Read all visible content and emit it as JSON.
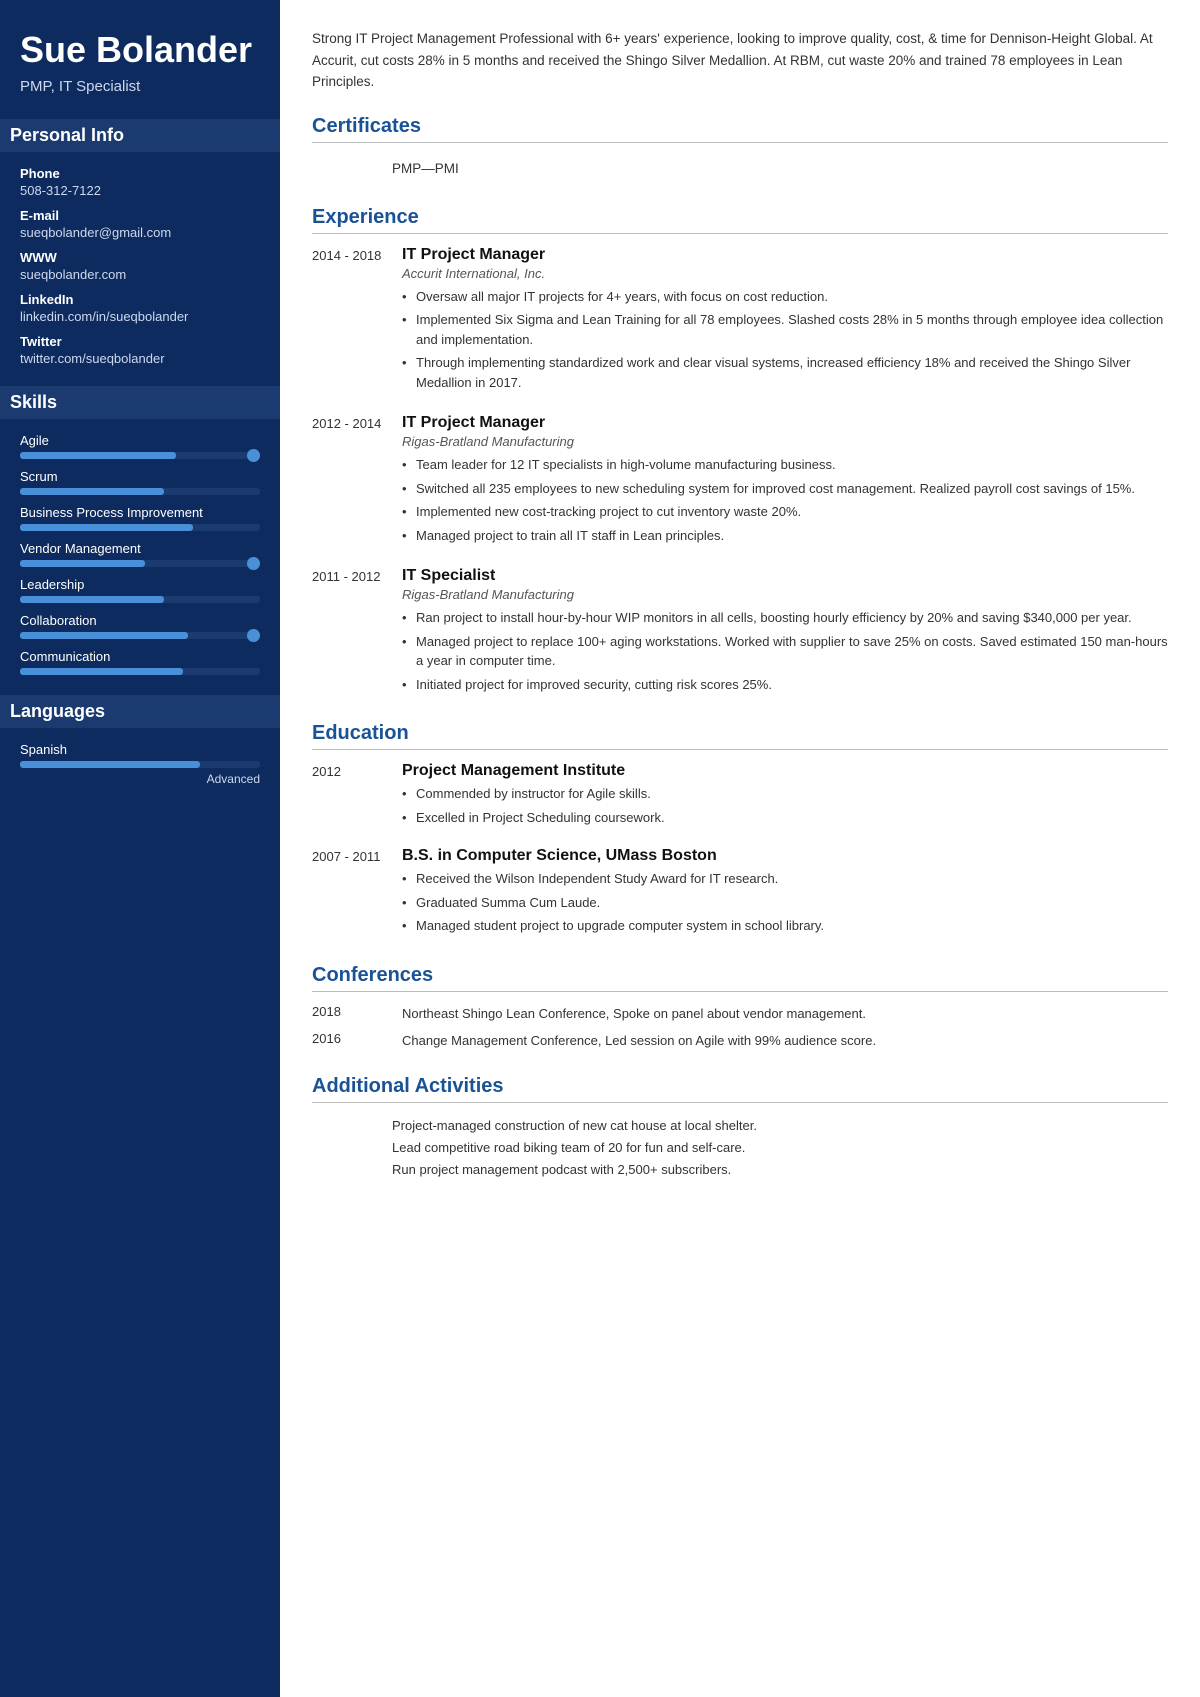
{
  "sidebar": {
    "name": "Sue Bolander",
    "title": "PMP, IT Specialist",
    "personal_info_header": "Personal Info",
    "phone_label": "Phone",
    "phone": "508-312-7122",
    "email_label": "E-mail",
    "email": "sueqbolander@gmail.com",
    "www_label": "WWW",
    "www": "sueqbolander.com",
    "linkedin_label": "LinkedIn",
    "linkedin": "linkedin.com/in/sueqbolander",
    "twitter_label": "Twitter",
    "twitter": "twitter.com/sueqbolander",
    "skills_header": "Skills",
    "skills": [
      {
        "name": "Agile",
        "fill_pct": 65,
        "has_dot": true
      },
      {
        "name": "Scrum",
        "fill_pct": 60,
        "has_dot": false
      },
      {
        "name": "Business Process Improvement",
        "fill_pct": 72,
        "has_dot": false
      },
      {
        "name": "Vendor Management",
        "fill_pct": 52,
        "has_dot": true
      },
      {
        "name": "Leadership",
        "fill_pct": 60,
        "has_dot": false
      },
      {
        "name": "Collaboration",
        "fill_pct": 70,
        "has_dot": true
      },
      {
        "name": "Communication",
        "fill_pct": 68,
        "has_dot": false
      }
    ],
    "languages_header": "Languages",
    "languages": [
      {
        "name": "Spanish",
        "fill_pct": 75,
        "level": "Advanced"
      }
    ]
  },
  "main": {
    "summary": "Strong IT Project Management Professional with 6+ years' experience, looking to improve quality, cost, & time for Dennison-Height Global. At Accurit, cut costs 28% in 5 months and received the Shingo Silver Medallion. At RBM, cut waste 20% and trained 78 employees in Lean Principles.",
    "certificates_title": "Certificates",
    "certificates": [
      {
        "name": "PMP—PMI"
      }
    ],
    "experience_title": "Experience",
    "experience": [
      {
        "dates": "2014 - 2018",
        "title": "IT Project Manager",
        "company": "Accurit International, Inc.",
        "bullets": [
          "Oversaw all major IT projects for 4+ years, with focus on cost reduction.",
          "Implemented Six Sigma and Lean Training for all 78 employees. Slashed costs 28% in 5 months through employee idea collection and implementation.",
          "Through implementing standardized work and clear visual systems, increased efficiency 18% and received the Shingo Silver Medallion in 2017."
        ]
      },
      {
        "dates": "2012 - 2014",
        "title": "IT Project Manager",
        "company": "Rigas-Bratland Manufacturing",
        "bullets": [
          "Team leader for 12 IT specialists in high-volume manufacturing business.",
          "Switched all 235 employees to new scheduling system for improved cost management. Realized payroll cost savings of 15%.",
          "Implemented new cost-tracking project to cut inventory waste 20%.",
          "Managed project to train all IT staff in Lean principles."
        ]
      },
      {
        "dates": "2011 - 2012",
        "title": "IT Specialist",
        "company": "Rigas-Bratland Manufacturing",
        "bullets": [
          "Ran project to install hour-by-hour WIP monitors in all cells, boosting hourly efficiency by 20% and saving $340,000 per year.",
          "Managed project to replace 100+ aging workstations. Worked with supplier to save 25% on costs. Saved estimated 150 man-hours a year in computer time.",
          "Initiated project for improved security, cutting risk scores 25%."
        ]
      }
    ],
    "education_title": "Education",
    "education": [
      {
        "dates": "2012",
        "institution": "Project Management Institute",
        "bullets": [
          "Commended by instructor for Agile skills.",
          "Excelled in Project Scheduling coursework."
        ]
      },
      {
        "dates": "2007 - 2011",
        "institution": "B.S. in Computer Science, UMass Boston",
        "bullets": [
          "Received the Wilson Independent Study Award for IT research.",
          "Graduated Summa Cum Laude.",
          "Managed student project to upgrade computer system in school library."
        ]
      }
    ],
    "conferences_title": "Conferences",
    "conferences": [
      {
        "year": "2018",
        "text": "Northeast Shingo Lean Conference, Spoke on panel about vendor management."
      },
      {
        "year": "2016",
        "text": "Change Management Conference, Led session on Agile with 99% audience score."
      }
    ],
    "additional_title": "Additional Activities",
    "activities": [
      "Project-managed construction of new cat house at local shelter.",
      "Lead competitive road biking team of 20 for fun and self-care.",
      "Run project management podcast with 2,500+ subscribers."
    ]
  }
}
